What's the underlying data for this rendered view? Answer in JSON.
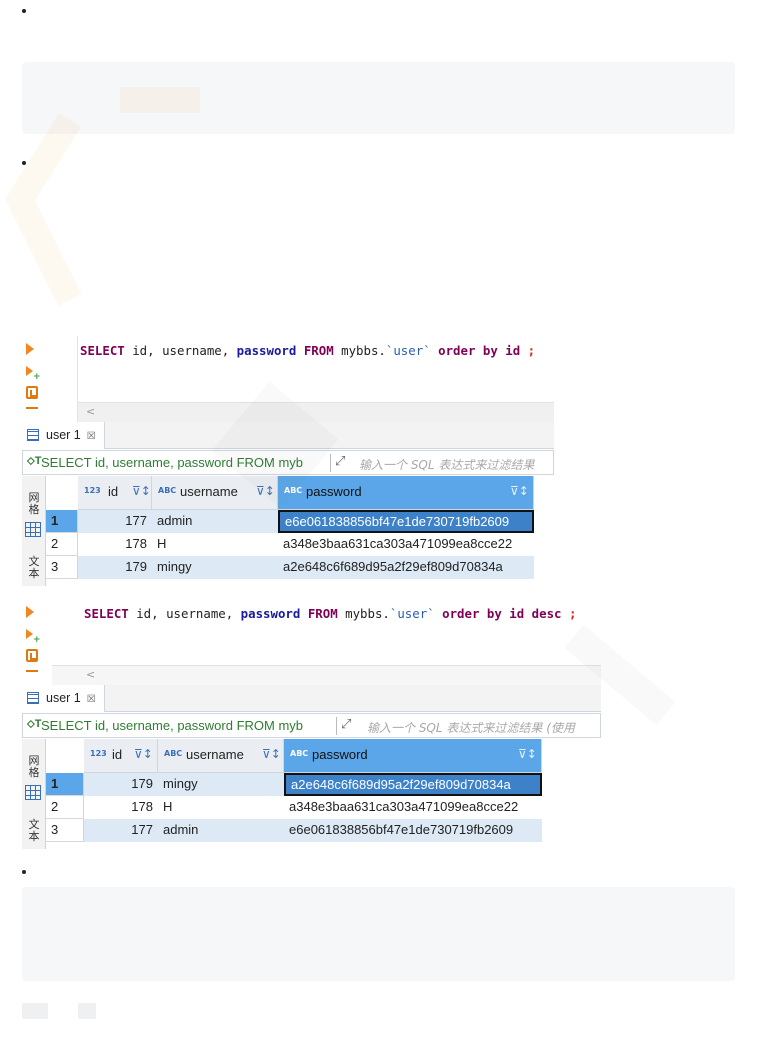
{
  "accent_color": "#5aa6e8",
  "panel1": {
    "sql": {
      "select": "SELECT",
      "cols": " id, username, ",
      "password": "password",
      "from": "FROM",
      "table_pre": " mybbs.",
      "table": "`user`",
      "order": "order by",
      "order_col": " id",
      "desc": "",
      "semi": " ;"
    },
    "tab_label": "user 1",
    "tab_close": "☒",
    "filter_sql": "SELECT id, username, password FROM myb",
    "filter_placeholder": "输入一个 SQL 表达式来过滤结果",
    "side_labels": [
      "网格",
      "文本"
    ],
    "columns": [
      {
        "type": "123",
        "label": "id"
      },
      {
        "type": "ABC",
        "label": "username"
      },
      {
        "type": "ABC",
        "label": "password"
      }
    ],
    "rows": [
      {
        "n": "1",
        "id": "177",
        "username": "admin",
        "password": "e6e061838856bf47e1de730719fb2609"
      },
      {
        "n": "2",
        "id": "178",
        "username": "H",
        "password": "a348e3baa631ca303a471099ea8cce22"
      },
      {
        "n": "3",
        "id": "179",
        "username": "mingy",
        "password": "a2e648c6f689d95a2f29ef809d70834a"
      }
    ]
  },
  "panel2": {
    "sql": {
      "select": "SELECT",
      "cols": " id, username, ",
      "password": "password",
      "from": "FROM",
      "table_pre": " mybbs.",
      "table": "`user`",
      "order": "order by",
      "order_col": " id ",
      "desc": "desc",
      "semi": " ;"
    },
    "tab_label": "user 1",
    "tab_close": "☒",
    "filter_sql": "SELECT id, username, password FROM myb",
    "filter_placeholder": "输入一个 SQL 表达式来过滤结果 (使用",
    "side_labels": [
      "网格",
      "文本"
    ],
    "columns": [
      {
        "type": "123",
        "label": "id"
      },
      {
        "type": "ABC",
        "label": "username"
      },
      {
        "type": "ABC",
        "label": "password"
      }
    ],
    "rows": [
      {
        "n": "1",
        "id": "179",
        "username": "mingy",
        "password": "a2e648c6f689d95a2f29ef809d70834a"
      },
      {
        "n": "2",
        "id": "178",
        "username": "H",
        "password": "a348e3baa631ca303a471099ea8cce22"
      },
      {
        "n": "3",
        "id": "177",
        "username": "admin",
        "password": "e6e061838856bf47e1de730719fb2609"
      }
    ]
  }
}
